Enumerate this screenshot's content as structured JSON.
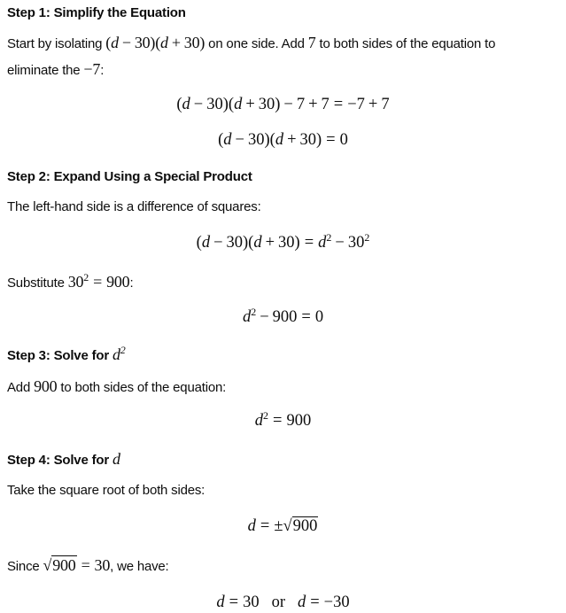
{
  "steps": [
    {
      "heading": "Step 1: Simplify the Equation",
      "text": {
        "p1a": "Start by isolating ",
        "p1_math": "(d − 30)(d + 30)",
        "p1b": " on one side. Add ",
        "p1_seven": "7",
        "p1c": " to both sides of the equation to",
        "p1d": "eliminate the ",
        "p1_neg7": "−7",
        "p1e": ":"
      },
      "equations": [
        "(d − 30)(d + 30) − 7 + 7 = −7 + 7",
        "(d − 30)(d + 30) = 0"
      ]
    },
    {
      "heading": "Step 2: Expand Using a Special Product",
      "text": {
        "p1": "The left-hand side is a difference of squares:",
        "p2a": "Substitute ",
        "p2_math": "30² = 900",
        "p2b": ":"
      },
      "equations": [
        "(d − 30)(d + 30) = d² − 30²",
        "d² − 900 = 0"
      ]
    },
    {
      "heading_prefix": "Step 3: Solve for ",
      "heading_math": "d²",
      "text": {
        "p1a": "Add ",
        "p1_math": "900",
        "p1b": " to both sides of the equation:"
      },
      "equations": [
        "d² = 900"
      ]
    },
    {
      "heading_prefix": "Step 4: Solve for ",
      "heading_math": "d",
      "text": {
        "p1": "Take the square root of both sides:",
        "p2a": "Since ",
        "p2_math": "√900 = 30",
        "p2b": ", we have:"
      },
      "equations": [
        "d = ±√900",
        "d = 30   or   d = −30"
      ]
    }
  ]
}
